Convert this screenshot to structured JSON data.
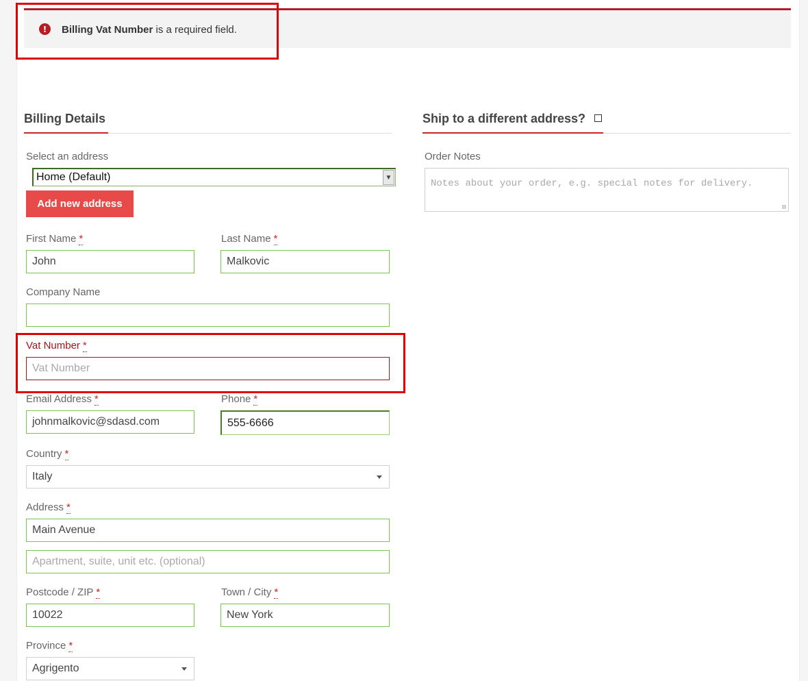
{
  "notice": {
    "field": "Billing Vat Number",
    "text": " is a required field.",
    "icon": "error-circle-icon",
    "color": "#b81c23"
  },
  "billing": {
    "title": "Billing Details",
    "select_address_label": "Select an address",
    "selected_address": "Home (Default)",
    "add_address_button": "Add new address",
    "required_marker": "*",
    "first_name": {
      "label": "First Name",
      "value": "John"
    },
    "last_name": {
      "label": "Last Name",
      "value": "Malkovic"
    },
    "company": {
      "label": "Company Name",
      "value": ""
    },
    "vat": {
      "label": "Vat Number",
      "placeholder": "Vat Number"
    },
    "email": {
      "label": "Email Address",
      "value": "johnmalkovic@sdasd.com"
    },
    "phone": {
      "label": "Phone",
      "value": "555-6666"
    },
    "country": {
      "label": "Country",
      "value": "Italy"
    },
    "address": {
      "label": "Address",
      "value": "Main Avenue",
      "placeholder2": "Apartment, suite, unit etc. (optional)"
    },
    "postcode": {
      "label": "Postcode / ZIP",
      "value": "10022"
    },
    "town": {
      "label": "Town / City",
      "value": "New York"
    },
    "province": {
      "label": "Province",
      "value": "Agrigento"
    }
  },
  "shipping": {
    "title": "Ship to a different address?",
    "order_notes_label": "Order Notes",
    "order_notes_placeholder": "Notes about your order, e.g. special notes for delivery."
  },
  "colors": {
    "accent": "#c9252c",
    "valid_border": "#7fc14a",
    "button": "#e84a4a"
  }
}
